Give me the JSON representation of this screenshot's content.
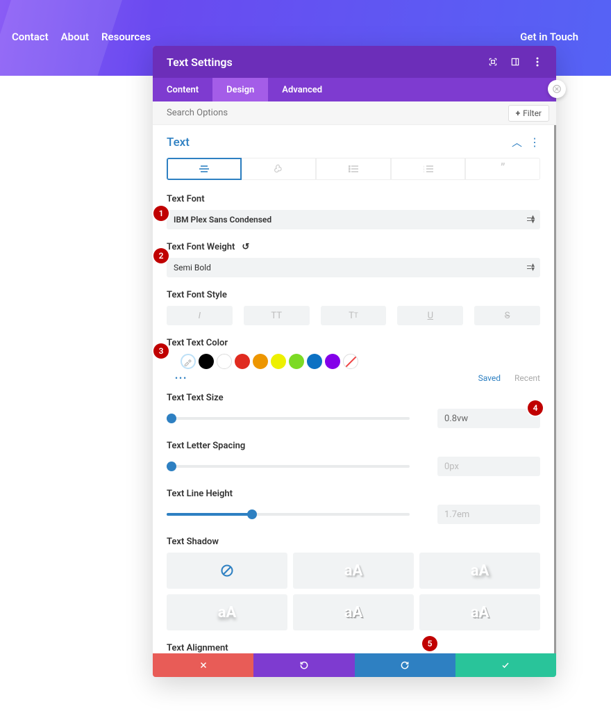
{
  "nav": {
    "items": [
      "Contact",
      "About",
      "Resources"
    ],
    "cta": "Get in Touch"
  },
  "panel": {
    "title": "Text Settings",
    "tabs": [
      "Content",
      "Design",
      "Advanced"
    ],
    "active_tab": 1,
    "search_placeholder": "Search Options",
    "filter_label": "Filter"
  },
  "section": {
    "title": "Text"
  },
  "type_tabs": {
    "icons": [
      "left-align",
      "leaf",
      "list-bullets",
      "list-numbered",
      "quote"
    ]
  },
  "fields": {
    "font_label": "Text Font",
    "font_value": "IBM Plex Sans Condensed",
    "weight_label": "Text Font Weight",
    "weight_value": "Semi Bold",
    "style_label": "Text Font Style",
    "color_label": "Text Text Color",
    "size_label": "Text Text Size",
    "size_value": "0.8vw",
    "letter_label": "Text Letter Spacing",
    "letter_value": "0px",
    "line_label": "Text Line Height",
    "line_value": "1.7em",
    "shadow_label": "Text Shadow",
    "align_label": "Text Alignment"
  },
  "colors": {
    "swatches": [
      "#000000",
      "#ffffff",
      "#e02b20",
      "#ed9600",
      "#edf000",
      "#7cda24",
      "#0c71c3",
      "#8300e9"
    ],
    "saved_label": "Saved",
    "recent_label": "Recent"
  },
  "shadow_text": "aA",
  "callouts": [
    "1",
    "2",
    "3",
    "4",
    "5"
  ]
}
